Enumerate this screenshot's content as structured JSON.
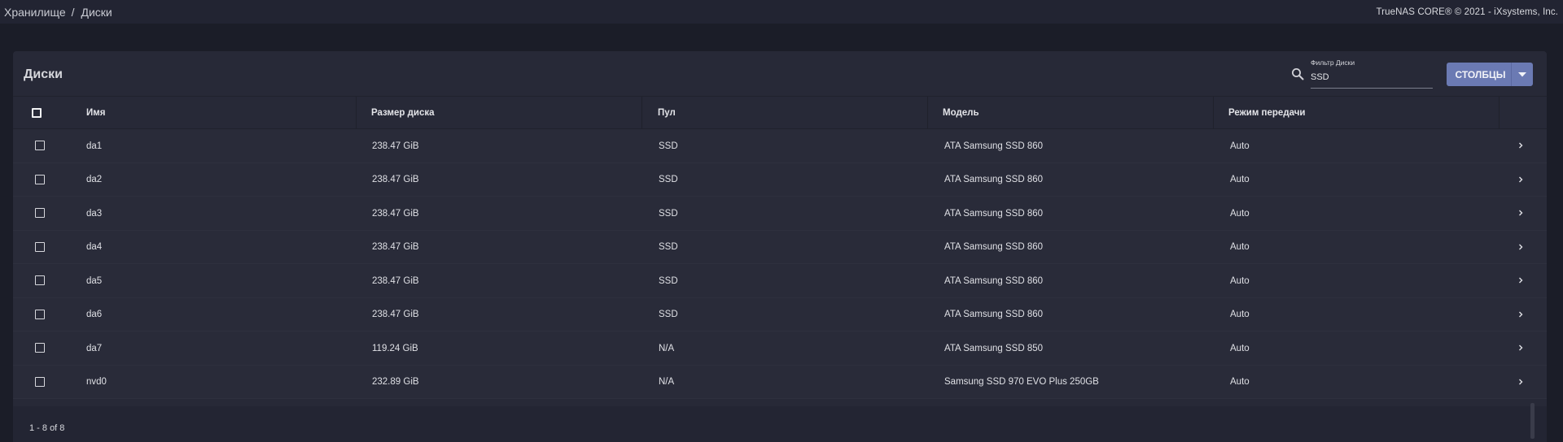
{
  "breadcrumb": [
    "Хранилище",
    "Диски"
  ],
  "breadcrumb_sep": "/",
  "copyright": "TrueNAS CORE® © 2021 - iXsystems, Inc.",
  "card": {
    "title": "Диски",
    "filter_label": "Фильтр Диски",
    "filter_value": "SSD",
    "columns_button": "СТОЛБЦЫ"
  },
  "columns": [
    "Имя",
    "Размер диска",
    "Пул",
    "Модель",
    "Режим передачи"
  ],
  "rows": [
    {
      "name": "da1",
      "size": "238.47 GiB",
      "pool": "SSD",
      "model": "ATA Samsung SSD 860",
      "mode": "Auto"
    },
    {
      "name": "da2",
      "size": "238.47 GiB",
      "pool": "SSD",
      "model": "ATA Samsung SSD 860",
      "mode": "Auto"
    },
    {
      "name": "da3",
      "size": "238.47 GiB",
      "pool": "SSD",
      "model": "ATA Samsung SSD 860",
      "mode": "Auto"
    },
    {
      "name": "da4",
      "size": "238.47 GiB",
      "pool": "SSD",
      "model": "ATA Samsung SSD 860",
      "mode": "Auto"
    },
    {
      "name": "da5",
      "size": "238.47 GiB",
      "pool": "SSD",
      "model": "ATA Samsung SSD 860",
      "mode": "Auto"
    },
    {
      "name": "da6",
      "size": "238.47 GiB",
      "pool": "SSD",
      "model": "ATA Samsung SSD 860",
      "mode": "Auto"
    },
    {
      "name": "da7",
      "size": "119.24 GiB",
      "pool": "N/A",
      "model": "ATA Samsung SSD 850",
      "mode": "Auto"
    },
    {
      "name": "nvd0",
      "size": "232.89 GiB",
      "pool": "N/A",
      "model": "Samsung SSD 970 EVO Plus 250GB",
      "mode": "Auto"
    }
  ],
  "footer": {
    "range": "1 - 8 of 8"
  },
  "colors": {
    "accent": "#6b7ab3",
    "background": "#1b1d28",
    "card": "#272937"
  },
  "icons": {
    "search": "search-icon",
    "dropdown": "caret-down-icon",
    "row_expand": "chevron-right-icon"
  }
}
